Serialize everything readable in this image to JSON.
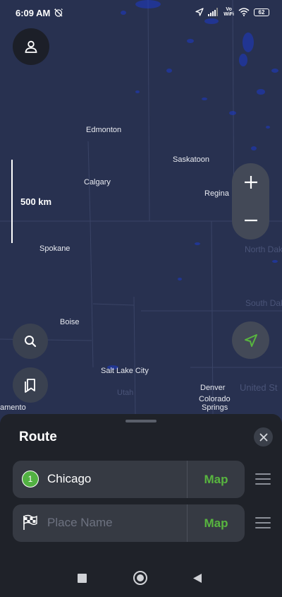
{
  "status_bar": {
    "time": "6:09 AM",
    "vowifi_top": "Vo",
    "vowifi_bottom": "WiFi",
    "battery": "62"
  },
  "map": {
    "scale_label": "500 km",
    "cities": {
      "edmonton": "Edmonton",
      "saskatoon": "Saskatoon",
      "calgary": "Calgary",
      "regina": "Regina",
      "spokane": "Spokane",
      "boise": "Boise",
      "salt_lake_city": "Salt Lake City",
      "utah": "Utah",
      "denver": "Denver",
      "colorado_springs_1": "Colorado",
      "colorado_springs_2": "Springs",
      "sacramento": "amento",
      "north_dakota": "North Dak",
      "south_dakota": "South Dak",
      "united_states": "United St"
    }
  },
  "route_panel": {
    "title": "Route",
    "stops": [
      {
        "badge": "1",
        "name": "Chicago",
        "map_label": "Map"
      },
      {
        "placeholder": "Place Name",
        "map_label": "Map"
      }
    ]
  },
  "colors": {
    "map_bg": "#283150",
    "sheet_bg": "#1f2229",
    "accent_green": "#58b53f"
  }
}
